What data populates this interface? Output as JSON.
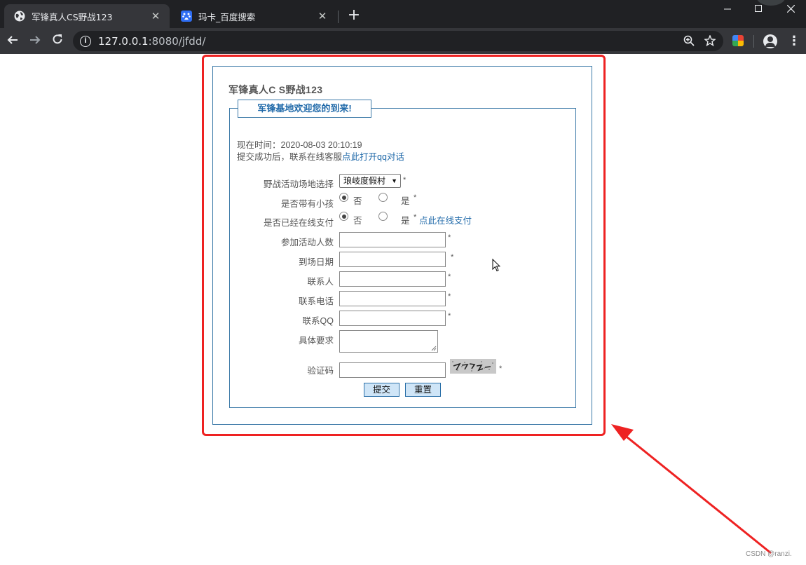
{
  "browser": {
    "tabs": [
      {
        "title": "军锋真人CS野战123",
        "favicon": "globe-icon",
        "active": true
      },
      {
        "title": "玛卡_百度搜索",
        "favicon": "baidu-paw-icon",
        "active": false
      }
    ],
    "close_glyph": "✕",
    "new_tab_glyph": "+",
    "url_host": "127.0.0.1",
    "url_rest": ":8080/jfdd/",
    "icons": [
      "back-icon",
      "forward-icon",
      "reload-icon",
      "info-icon",
      "zoom-icon",
      "star-icon",
      "extension-icon",
      "profile-icon",
      "menu-icon"
    ]
  },
  "page": {
    "site_title": "军锋真人C S野战123",
    "legend": "军锋基地欢迎您的到来!",
    "time_label": "现在时间：",
    "time_value": "2020-08-03 20:10:19",
    "tip_prefix": "提交成功后，联系在线客服",
    "tip_link": "点此打开qq对话",
    "form": {
      "venue_label": "野战活动场地选择",
      "venue_selected": "琅岐度假村",
      "child_label": "是否带有小孩",
      "paid_label": "是否已经在线支付",
      "option_no": "否",
      "option_yes": "是",
      "pay_link": "点此在线支付",
      "people_label": "参加活动人数",
      "date_label": "到场日期",
      "contact_label": "联系人",
      "phone_label": "联系电话",
      "qq_label": "联系QQ",
      "requirements_label": "具体要求",
      "captcha_label": "验证码",
      "required_mark": "*",
      "people_value": "",
      "date_value": "",
      "contact_value": "",
      "phone_value": "",
      "qq_value": "",
      "captcha_value": "",
      "child_selected": "否",
      "paid_selected": "否"
    },
    "buttons": {
      "submit": "提交",
      "reset": "重置"
    }
  },
  "watermark": "CSDN @ranzi.",
  "colors": {
    "annotation": "#ee2222",
    "panel_border": "#3d7aa8",
    "link": "#1f69a9",
    "button_bg": "#cfe5f7"
  }
}
